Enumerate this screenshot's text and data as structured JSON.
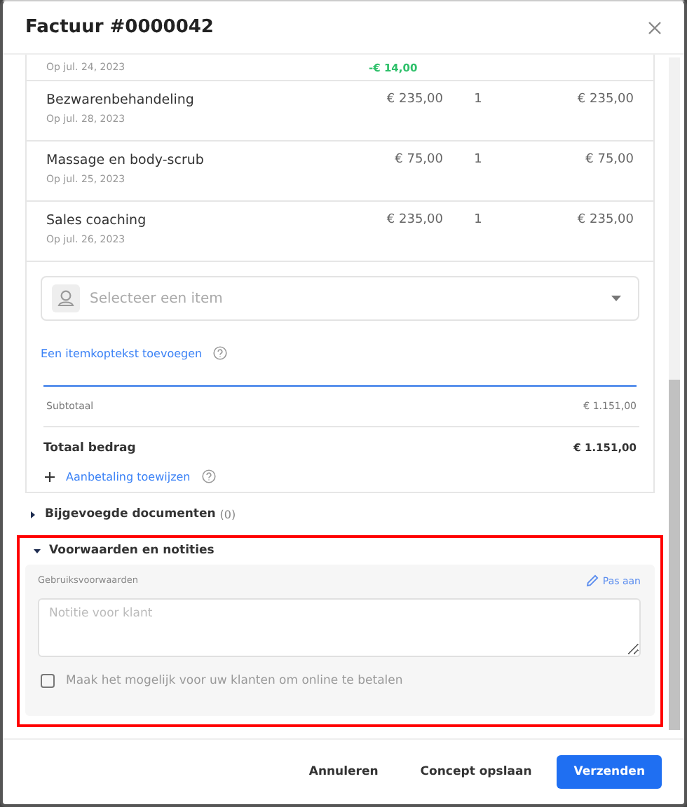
{
  "dialog": {
    "title": "Factuur #0000042"
  },
  "line_items": [
    {
      "kind": "discount",
      "date": "Op jul. 24, 2023",
      "amount": "-€ 14,00"
    },
    {
      "kind": "item",
      "name": "Bezwarenbehandeling",
      "date": "Op jul. 28, 2023",
      "price": "€ 235,00",
      "quantity": "1",
      "total": "€ 235,00"
    },
    {
      "kind": "item",
      "name": "Massage en body-scrub",
      "date": "Op jul. 25, 2023",
      "price": "€ 75,00",
      "quantity": "1",
      "total": "€ 75,00"
    },
    {
      "kind": "item",
      "name": "Sales coaching",
      "date": "Op jul. 26, 2023",
      "price": "€ 235,00",
      "quantity": "1",
      "total": "€ 235,00"
    }
  ],
  "item_select": {
    "placeholder": "Selecteer een item"
  },
  "header_link": "Een itemkoptekst toevoegen",
  "subtotal": {
    "label": "Subtotaal",
    "value": "€ 1.151,00"
  },
  "total": {
    "label": "Totaal bedrag",
    "value": "€ 1.151,00"
  },
  "deposit_link": "Aanbetaling toewijzen",
  "attachments": {
    "label": "Bijgevoegde documenten",
    "count": "(0)",
    "expanded": false
  },
  "terms": {
    "label": "Voorwaarden en notities",
    "expanded": true,
    "field_label": "Gebruiksvoorwaarden",
    "edit_link": "Pas aan",
    "note_placeholder": "Notitie voor klant",
    "online_payment": {
      "label": "Maak het mogelijk voor uw klanten om online te betalen",
      "checked": false
    }
  },
  "buttons": [
    {
      "label": "Annuleren",
      "kind": "text"
    },
    {
      "label": "Concept opslaan",
      "kind": "text"
    },
    {
      "label": "Verzenden",
      "kind": "primary"
    }
  ]
}
